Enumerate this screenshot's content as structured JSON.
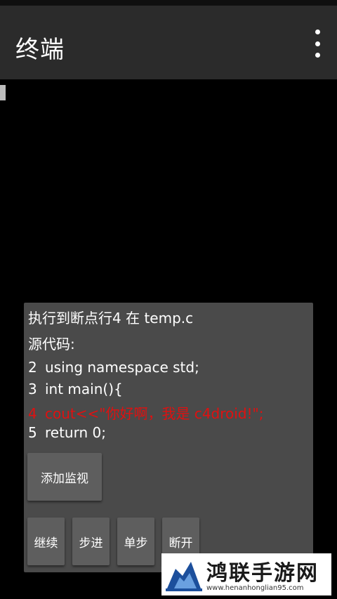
{
  "app_bar": {
    "title": "终端",
    "menu_icon": "more-vert-icon"
  },
  "debug_panel": {
    "status_line": "执行到断点行4 在 temp.c",
    "source_label": "源代码:",
    "code_lines": [
      {
        "num": "2",
        "text": "using namespace std;",
        "highlight": false
      },
      {
        "num": "3",
        "text": "int main(){",
        "highlight": false
      },
      {
        "num": "4",
        "text": "cout<<\"你好啊，我是 c4droid!\";",
        "highlight": true
      },
      {
        "num": "5",
        "text": "return 0;",
        "highlight": false
      }
    ],
    "buttons": {
      "add_watch": "添加监视",
      "continue": "继续",
      "step_over": "步进",
      "step_into": "单步",
      "disconnect": "断开"
    }
  },
  "watermark": {
    "title": "鸿联手游网",
    "url": "www.henanhonglian95.com"
  },
  "colors": {
    "app_bar": "#2b2b2b",
    "panel": "#4a4a4a",
    "button": "#5e5e5e",
    "highlight": "#e01010"
  }
}
